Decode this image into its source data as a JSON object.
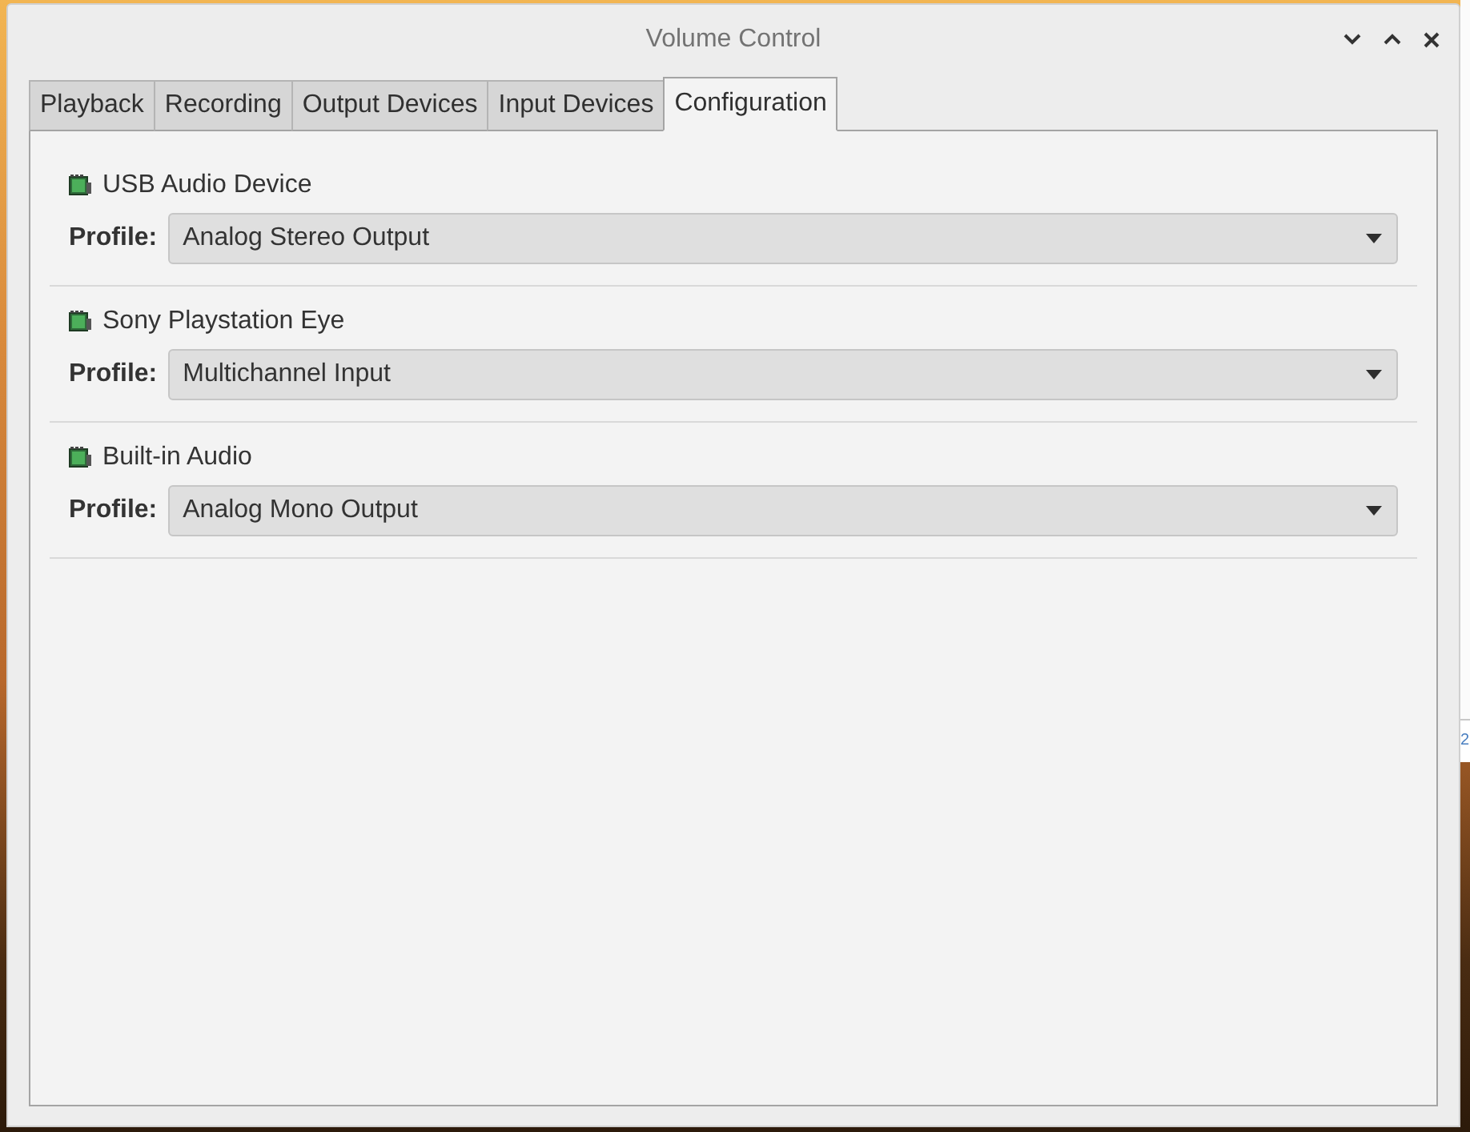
{
  "window": {
    "title": "Volume Control"
  },
  "tabs": [
    {
      "label": "Playback",
      "selected": false
    },
    {
      "label": "Recording",
      "selected": false
    },
    {
      "label": "Output Devices",
      "selected": false
    },
    {
      "label": "Input Devices",
      "selected": false
    },
    {
      "label": "Configuration",
      "selected": true
    }
  ],
  "devices": [
    {
      "name": "USB Audio Device",
      "profile_label": "Profile:",
      "profile": "Analog Stereo Output"
    },
    {
      "name": "Sony Playstation Eye",
      "profile_label": "Profile:",
      "profile": "Multichannel Input"
    },
    {
      "name": "Built-in Audio",
      "profile_label": "Profile:",
      "profile": "Analog Mono Output"
    }
  ],
  "background_window": {
    "text": "2"
  }
}
